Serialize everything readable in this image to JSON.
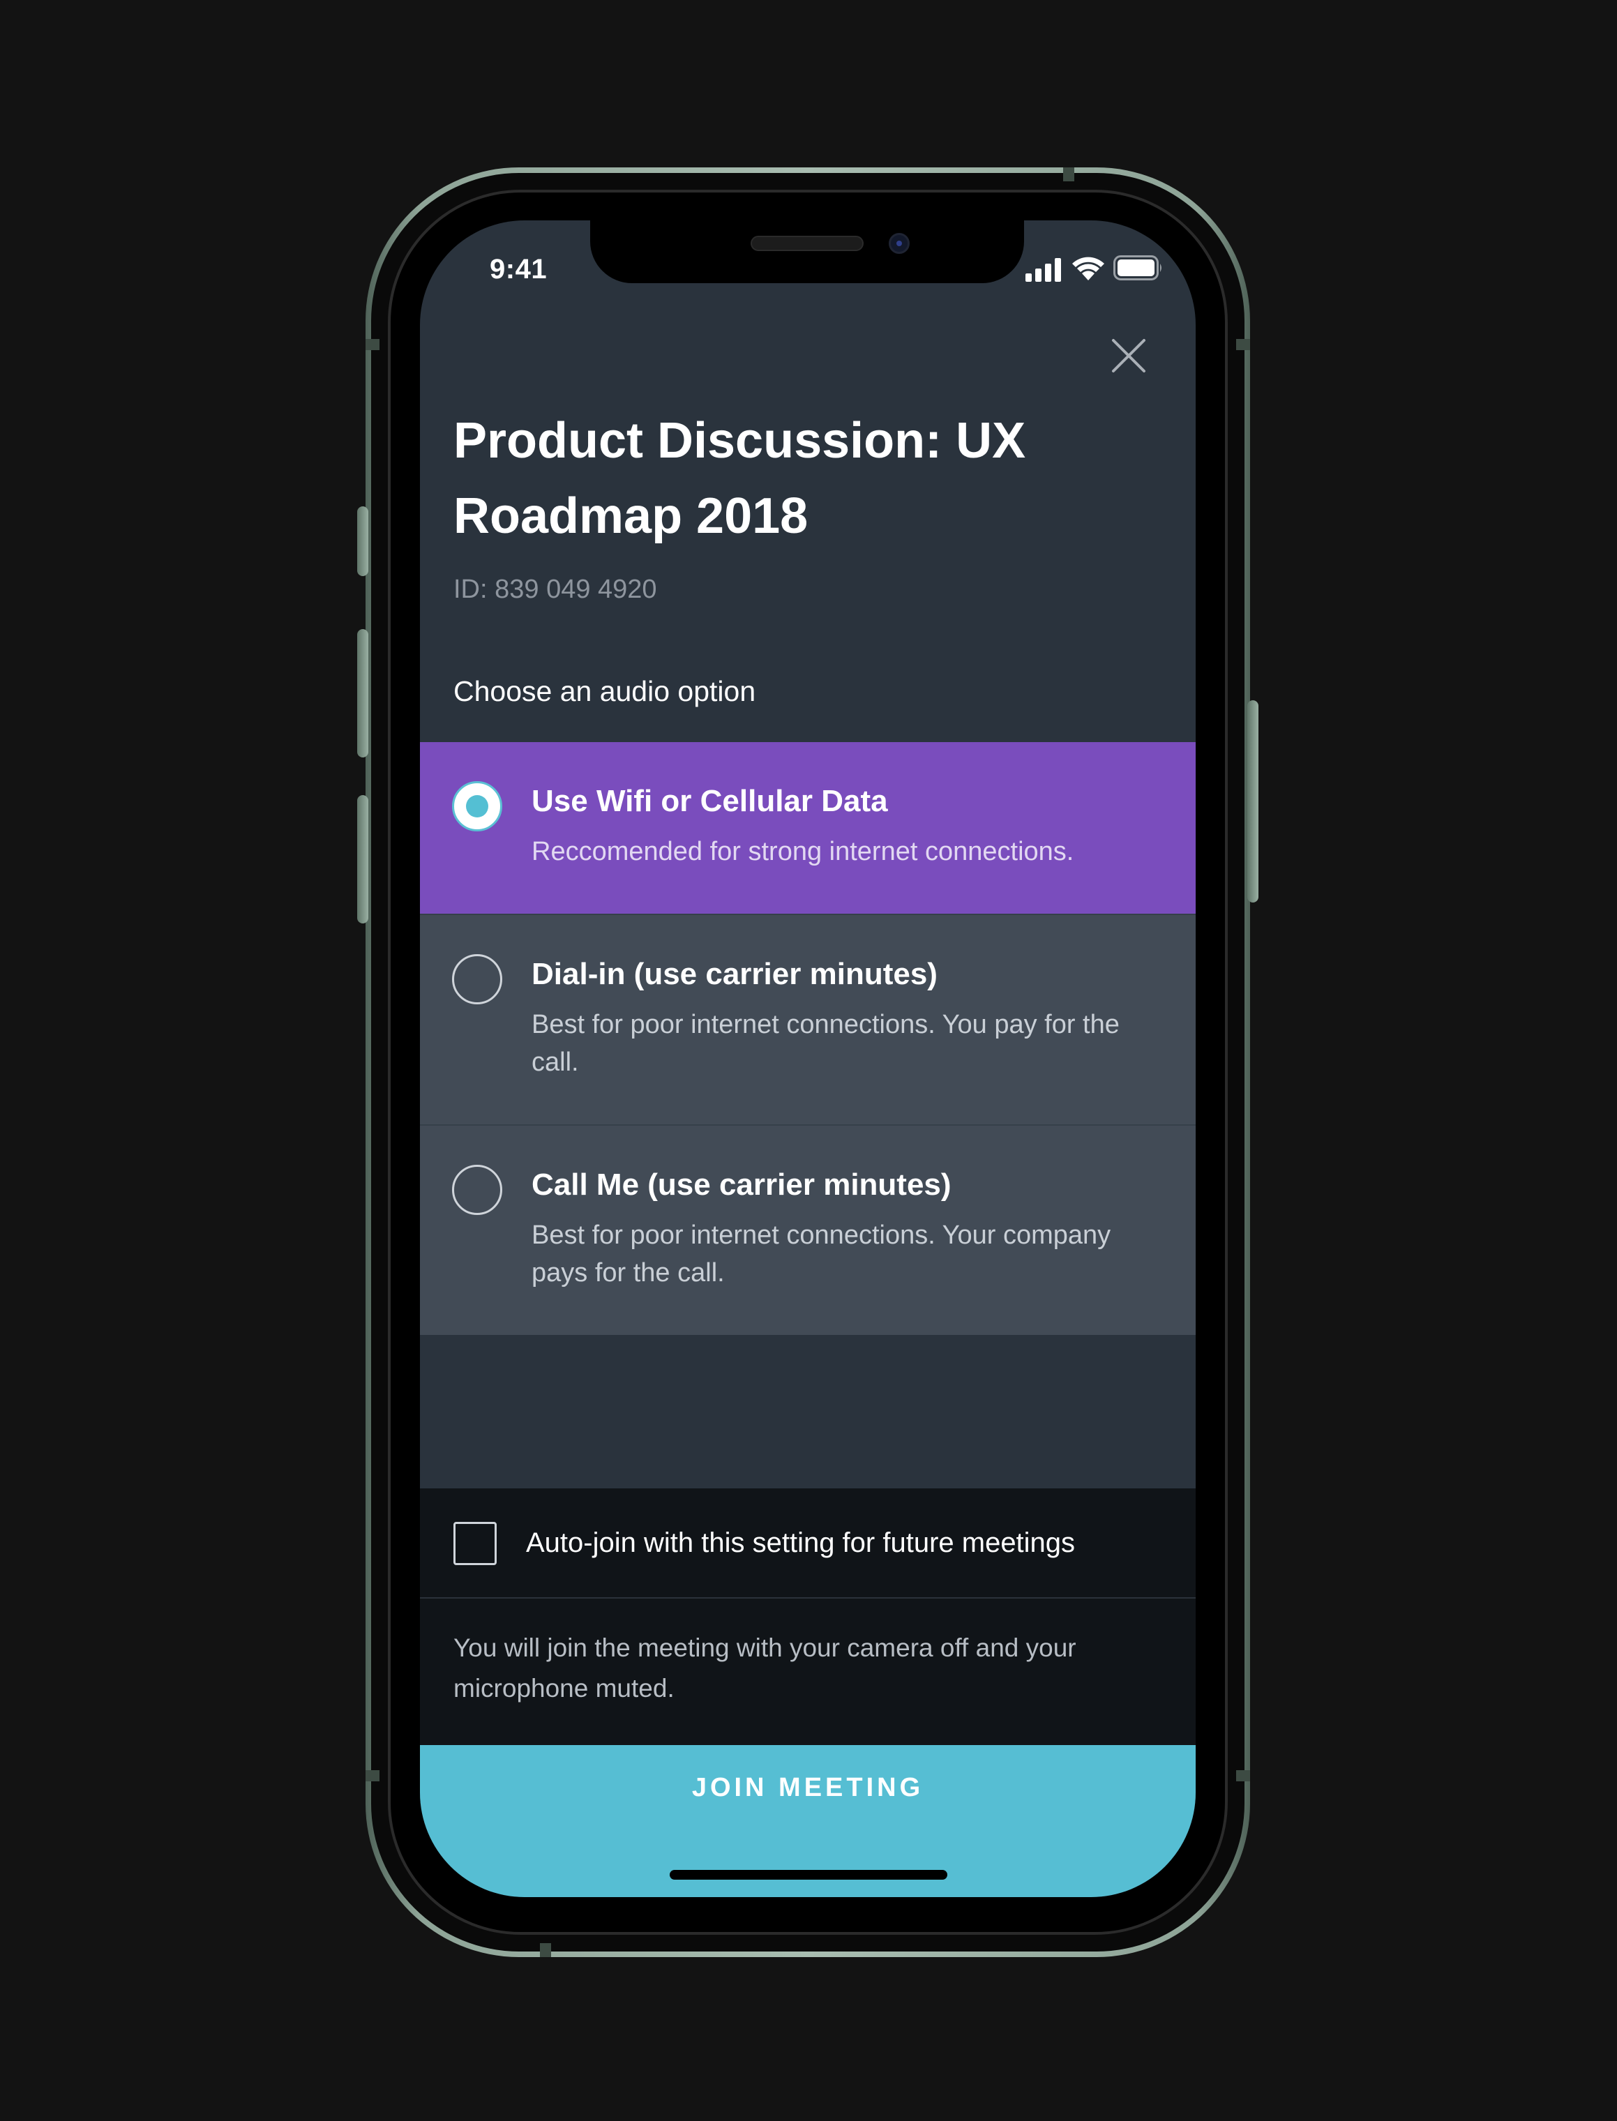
{
  "status_bar": {
    "time": "9:41"
  },
  "header": {
    "title": "Product Discussion: UX Roadmap 2018",
    "meeting_id": "ID: 839 049 4920"
  },
  "audio": {
    "section_label": "Choose an audio option",
    "options": [
      {
        "title": "Use Wifi or Cellular Data",
        "description": "Reccomended for strong internet connections.",
        "selected": true
      },
      {
        "title": "Dial-in (use carrier minutes)",
        "description": "Best for poor internet connections. You pay for the call.",
        "selected": false
      },
      {
        "title": "Call Me (use carrier minutes)",
        "description": "Best for poor internet connections. Your company pays for the call.",
        "selected": false
      }
    ]
  },
  "auto_join": {
    "label": "Auto-join with this setting for future meetings",
    "checked": false
  },
  "info_text": "You will join the meeting with your camera off and your microphone muted.",
  "join_button": {
    "label": "JOIN MEETING"
  },
  "colors": {
    "accent_purple": "#7a4dbd",
    "accent_teal": "#56bed3",
    "background": "#2a333d"
  },
  "icons": {
    "close": "close-icon",
    "signal": "cellular-signal-icon",
    "wifi": "wifi-icon",
    "battery": "battery-icon"
  }
}
